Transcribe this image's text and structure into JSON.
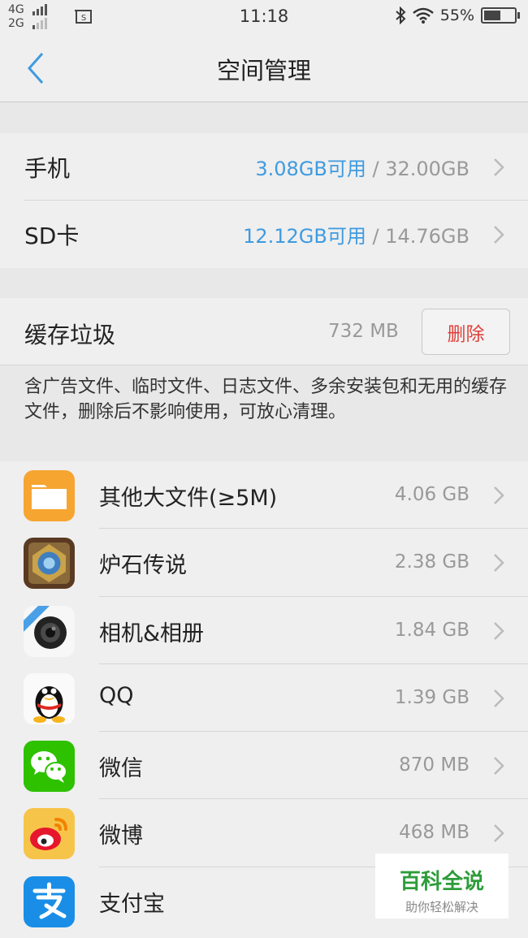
{
  "status_bar": {
    "net_top": "4G",
    "net_bottom": "2G",
    "time": "11:18",
    "battery": "55%",
    "battery_level": 0.55
  },
  "header": {
    "title": "空间管理"
  },
  "storage": [
    {
      "label": "手机",
      "available": "3.08GB可用",
      "total": " / 32.00GB"
    },
    {
      "label": "SD卡",
      "available": "12.12GB可用",
      "total": " / 14.76GB"
    }
  ],
  "cache": {
    "label": "缓存垃圾",
    "size": "732 MB",
    "delete_label": "删除",
    "note": "含广告文件、临时文件、日志文件、多余安装包和无用的缓存文件，删除后不影响使用，可放心清理。"
  },
  "apps": [
    {
      "name": "其他大文件(≥5M)",
      "size": "4.06 GB",
      "icon": "folder-icon"
    },
    {
      "name": "炉石传说",
      "size": "2.38 GB",
      "icon": "hearthstone-icon"
    },
    {
      "name": "相机&相册",
      "size": "1.84 GB",
      "icon": "camera-icon"
    },
    {
      "name": "QQ",
      "size": "1.39 GB",
      "icon": "qq-icon"
    },
    {
      "name": "微信",
      "size": "870 MB",
      "icon": "wechat-icon"
    },
    {
      "name": "微博",
      "size": "468 MB",
      "icon": "weibo-icon"
    },
    {
      "name": "支付宝",
      "size": "",
      "icon": "alipay-icon"
    }
  ],
  "watermark": {
    "title": "百科全说",
    "subtitle": "助你轻松解决"
  },
  "colors": {
    "accent": "#3e9be0",
    "danger": "#e0403a",
    "watermark": "#2e9c3a"
  }
}
